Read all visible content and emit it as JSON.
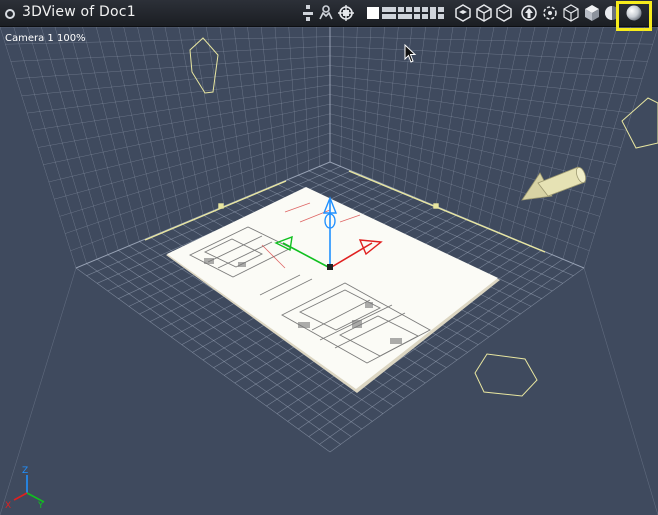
{
  "window": {
    "title": "3DView of Doc1",
    "camera_label": "Camera 1 100%"
  },
  "toolbar": {
    "items": [
      {
        "icon": "hierarchy-icon"
      },
      {
        "icon": "walk-icon"
      },
      {
        "icon": "orbit-icon"
      },
      {
        "icon": "single-view-icon"
      },
      {
        "icon": "two-horizontal-views-icon"
      },
      {
        "icon": "two-vertical-views-icon"
      },
      {
        "icon": "four-views-icon"
      },
      {
        "icon": "three-views-icon"
      },
      {
        "icon": "cube-front-icon"
      },
      {
        "icon": "cube-iso-icon"
      },
      {
        "icon": "cube-top-icon"
      },
      {
        "icon": "up-arrow-circle-icon"
      },
      {
        "icon": "fit-all-icon"
      },
      {
        "icon": "wireframe-cube-icon"
      },
      {
        "icon": "solid-cube-icon"
      },
      {
        "icon": "half-shaded-sphere-icon"
      },
      {
        "icon": "shaded-sphere-icon"
      }
    ],
    "highlight_color": "#f7ec1c"
  },
  "scene": {
    "background_color": "#3f4a5e",
    "grid_color": "#a9b4c6",
    "selection_color": "#e8e6a0",
    "gizmo_colors": {
      "x": "#e02020",
      "y": "#10c020",
      "z": "#2090ff"
    },
    "axis_triad": {
      "x": "X",
      "y": "Y",
      "z": "Z"
    }
  }
}
